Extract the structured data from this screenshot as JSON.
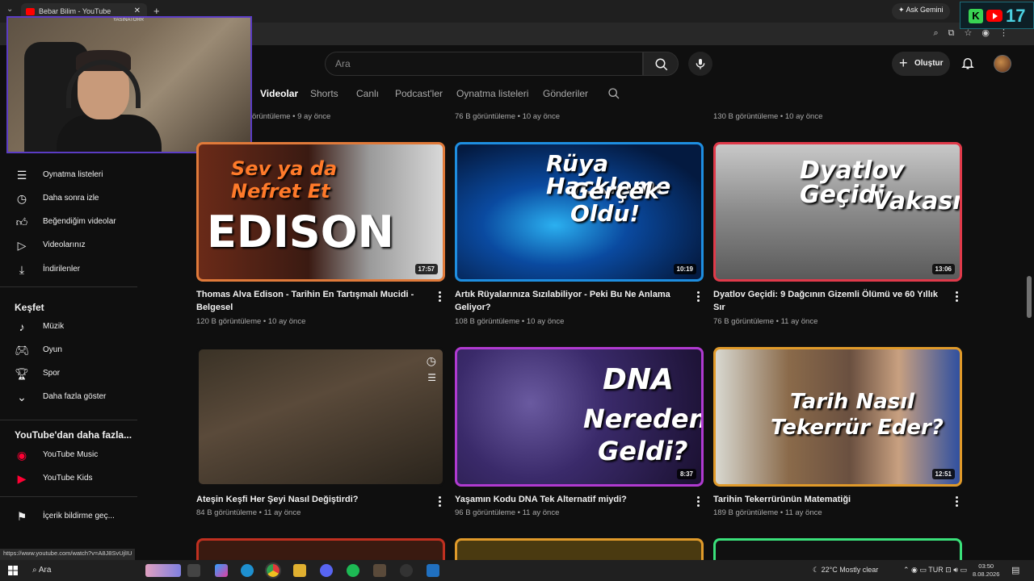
{
  "browser": {
    "tab_title": "Bebar Bilim - YouTube",
    "close_glyph": "✕",
    "new_tab_glyph": "+",
    "gemini_label": "Ask Gemini",
    "overlay_number": "17",
    "status_url": "https://www.youtube.com/watch?v=A8J8SvUjlIU"
  },
  "masthead": {
    "search_placeholder": "Ara",
    "create_label": "Oluştur"
  },
  "channel_tabs": [
    "Videolar",
    "Shorts",
    "Canlı",
    "Podcast'ler",
    "Oynatma listeleri",
    "Gönderiler"
  ],
  "active_tab": "Videolar",
  "webcam": {
    "label": "YASINATORR"
  },
  "sidebar": {
    "you_items": [
      {
        "icon": "playlist-icon",
        "label": "Oynatma listeleri"
      },
      {
        "icon": "clock-icon",
        "label": "Daha sonra izle"
      },
      {
        "icon": "thumbs-up-icon",
        "label": "Beğendiğim videolar"
      },
      {
        "icon": "play-square-icon",
        "label": "Videolarınız"
      },
      {
        "icon": "download-icon",
        "label": "İndirilenler"
      }
    ],
    "explore_title": "Keşfet",
    "explore_items": [
      {
        "icon": "music-note-icon",
        "label": "Müzik"
      },
      {
        "icon": "gamepad-icon",
        "label": "Oyun"
      },
      {
        "icon": "trophy-icon",
        "label": "Spor"
      },
      {
        "icon": "chevron-down-icon",
        "label": "Daha fazla göster"
      }
    ],
    "more_title": "YouTube'dan daha fazla...",
    "more_items": [
      {
        "icon": "youtube-music-icon",
        "label": "YouTube Music"
      },
      {
        "icon": "youtube-kids-icon",
        "label": "YouTube Kids"
      }
    ],
    "report_label": "İçerik bildirme geç..."
  },
  "top_row_meta": [
    "örüntüleme • 9 ay önce",
    "76 B görüntüleme • 10 ay önce",
    "130 B görüntüleme • 10 ay önce"
  ],
  "videos": [
    {
      "thumb_text_1": "Sev ya da",
      "thumb_text_2": "Nefret Et",
      "thumb_text_3": "EDISON",
      "duration": "17:57",
      "title": "Thomas Alva Edison - Tarihin En Tartışmalı Mucidi - Belgesel",
      "meta": "120 B görüntüleme • 10 ay önce",
      "border": "#e07a3a"
    },
    {
      "thumb_text_1": "Rüya Hackleme",
      "thumb_text_2": "Gerçek Oldu!",
      "thumb_text_3": "",
      "duration": "10:19",
      "title": "Artık Rüyalarınıza Sızılabiliyor - Peki Bu Ne Anlama Geliyor?",
      "meta": "108 B görüntüleme • 10 ay önce",
      "border": "#1e8ee0"
    },
    {
      "thumb_text_1": "Dyatlov Geçidi",
      "thumb_text_2": "Vakası",
      "thumb_text_3": "",
      "duration": "13:06",
      "title": "Dyatlov Geçidi: 9 Dağcının Gizemli Ölümü ve 60 Yıllık Sır",
      "meta": "76 B görüntüleme • 11 ay önce",
      "border": "#e03a4a"
    },
    {
      "thumb_text_1": "",
      "thumb_text_2": "",
      "thumb_text_3": "",
      "duration": "",
      "title": "Ateşin Keşfi Her Şeyi Nasıl Değiştirdi?",
      "meta": "84 B görüntüleme • 11 ay önce",
      "border": "#3a3a3a"
    },
    {
      "thumb_text_1": "DNA",
      "thumb_text_2": "Nereden",
      "thumb_text_3": "Geldi?",
      "duration": "8:37",
      "title": "Yaşamın Kodu DNA Tek Alternatif miydi?",
      "meta": "96 B görüntüleme • 11 ay önce",
      "border": "#b03ad0"
    },
    {
      "thumb_text_1": "Tarih Nasıl",
      "thumb_text_2": "Tekerrür Eder?",
      "thumb_text_3": "",
      "duration": "12:51",
      "title": "Tarihin Tekerrürünün Matematiği",
      "meta": "189 B görüntüleme • 11 ay önce",
      "border": "#e09a2a"
    }
  ],
  "taskbar": {
    "search_label": "Ara",
    "weather": "22°C  Mostly clear",
    "lang": "TUR",
    "time": "03:50",
    "date": "8.08.2026"
  }
}
